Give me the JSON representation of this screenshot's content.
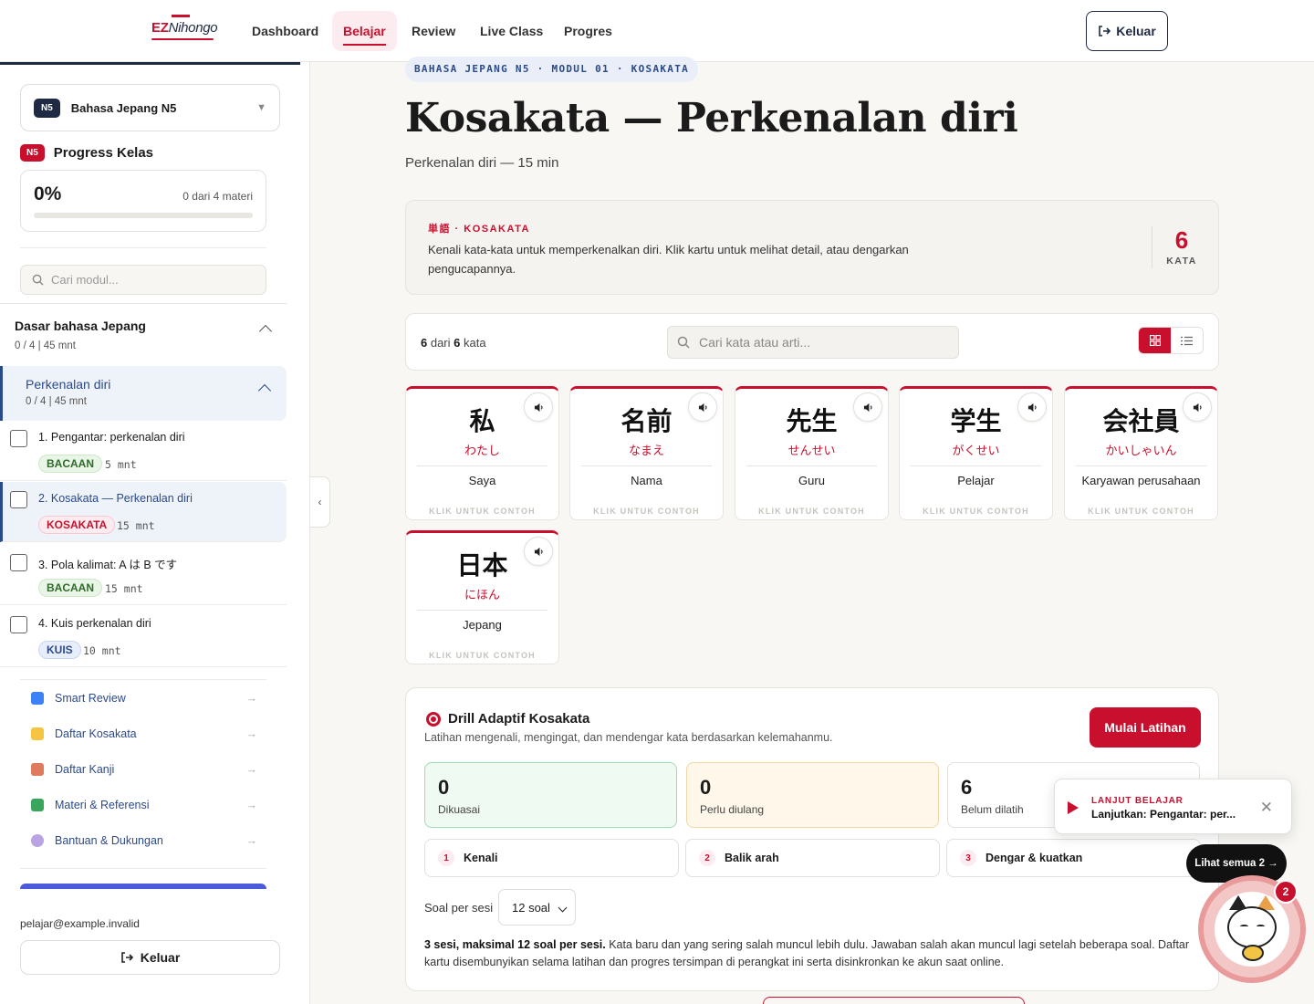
{
  "app": {
    "logo_ez": "EZ",
    "logo_rest": "Nihongo"
  },
  "topnav": {
    "items": [
      {
        "label": "Dashboard"
      },
      {
        "label": "Belajar"
      },
      {
        "label": "Review"
      },
      {
        "label": "Live Class"
      },
      {
        "label": "Progres"
      }
    ],
    "active": "Belajar",
    "logout_label": "Keluar"
  },
  "sidebar": {
    "course_badge": "N5",
    "course_name": "Bahasa Jepang N5",
    "progress_badge": "N5",
    "progress_title": "Progress Kelas",
    "progress_pct": "0%",
    "progress_value": 0,
    "progress_count": "0 dari 4 materi",
    "search_placeholder": "Cari modul...",
    "section": {
      "title": "Dasar bahasa Jepang",
      "meta": "0 / 4 | 45 mnt"
    },
    "subsection": {
      "title": "Perkenalan diri",
      "meta": "0 / 4 | 45 mnt"
    },
    "lessons": [
      {
        "title": "1. Pengantar: perkenalan diri",
        "tag": "BACAAN",
        "duration": "5 mnt"
      },
      {
        "title": "2. Kosakata — Perkenalan diri",
        "tag": "KOSAKATA",
        "duration": "15 mnt"
      },
      {
        "title": "3. Pola kalimat: A は B です",
        "tag": "BACAAN",
        "duration": "15 mnt"
      },
      {
        "title": "4. Kuis perkenalan diri",
        "tag": "KUIS",
        "duration": "10 mnt"
      }
    ],
    "links": [
      {
        "label": "Smart Review",
        "icon": "refresh-icon",
        "color": "#3b82f6"
      },
      {
        "label": "Daftar Kosakata",
        "icon": "notebook-icon",
        "color": "#f5c542"
      },
      {
        "label": "Daftar Kanji",
        "icon": "memo-icon",
        "color": "#e07a5f"
      },
      {
        "label": "Materi & Referensi",
        "icon": "books-icon",
        "color": "#3aa55d"
      },
      {
        "label": "Bantuan & Dukungan",
        "icon": "speech-bubble-icon",
        "color": "#b9a3e3"
      }
    ],
    "link_arrow": "→",
    "email": "pelajar@example.invalid",
    "logout_label": "Keluar"
  },
  "main": {
    "breadcrumb": "BAHASA JEPANG N5 · MODUL 01 · KOSAKATA",
    "title": "Kosakata — Perkenalan diri",
    "subtitle": "Perkenalan diri — 15 min",
    "intro": {
      "label": "単語 · KOSAKATA",
      "description": "Kenali kata-kata untuk memperkenalkan diri. Klik kartu untuk melihat detail, atau dengarkan pengucapannya.",
      "count": "6",
      "count_unit": "KATA"
    },
    "toolbar": {
      "shown": "6",
      "sep": " dari ",
      "total": "6",
      "suffix": " kata",
      "search_placeholder": "Cari kata atau arti..."
    },
    "words": [
      {
        "kanji": "私",
        "kana": "わたし",
        "meaning": "Saya"
      },
      {
        "kanji": "名前",
        "kana": "なまえ",
        "meaning": "Nama"
      },
      {
        "kanji": "先生",
        "kana": "せんせい",
        "meaning": "Guru"
      },
      {
        "kanji": "学生",
        "kana": "がくせい",
        "meaning": "Pelajar"
      },
      {
        "kanji": "会社員",
        "kana": "かいしゃいん",
        "meaning": "Karyawan perusahaan"
      },
      {
        "kanji": "日本",
        "kana": "にほん",
        "meaning": "Jepang"
      }
    ],
    "card_hint": "KLIK UNTUK CONTOH",
    "drill": {
      "title": "Drill Adaptif Kosakata",
      "subtitle": "Latihan mengenali, mengingat, dan mendengar kata berdasarkan kelemahanmu.",
      "start_label": "Mulai Latihan",
      "stats": [
        {
          "value": "0",
          "label": "Dikuasai",
          "bg": "#eefaf2",
          "border": "#9fdcb3"
        },
        {
          "value": "0",
          "label": "Perlu diulang",
          "bg": "#fff7ea",
          "border": "#f1d7a6"
        },
        {
          "value": "6",
          "label": "Belum dilatih",
          "bg": "#ffffff",
          "border": "#e2e0da"
        }
      ],
      "steps": [
        {
          "num": "1",
          "label": "Kenali"
        },
        {
          "num": "2",
          "label": "Balik arah"
        },
        {
          "num": "3",
          "label": "Dengar & kuatkan"
        }
      ],
      "per_session_label": "Soal per sesi",
      "per_session_value": "12 soal",
      "note_bold": "3 sesi, maksimal 12 soal per sesi.",
      "note_rest": " Kata baru dan yang sering salah muncul lebih dulu. Jawaban salah akan muncul lagi setelah beberapa soal. Daftar kartu disembunyikan selama latihan dan progres tersimpan di perangkat ini serta disinkronkan ke akun saat online."
    }
  },
  "toast": {
    "kicker": "LANJUT BELAJAR",
    "text": "Lanjutkan: Pengantar: per..."
  },
  "see_all": "Lihat semua 2 →",
  "notification_count": "2",
  "colors": {
    "accent": "#c8102e",
    "navy": "#1f2a44",
    "link_blue": "#2b4a8a"
  }
}
